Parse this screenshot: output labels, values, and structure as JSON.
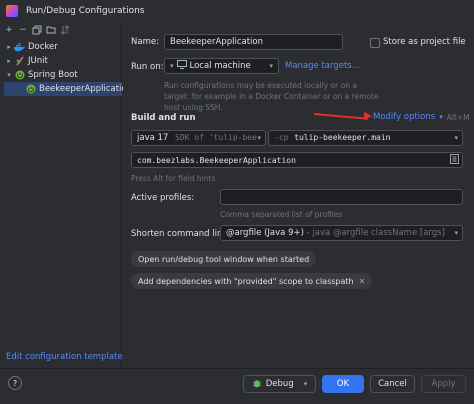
{
  "window": {
    "title": "Run/Debug Configurations"
  },
  "toolbar": {
    "add": "+",
    "remove": "−"
  },
  "tree": {
    "items": [
      {
        "label": "Docker",
        "expanded": false
      },
      {
        "label": "JUnit",
        "expanded": false
      },
      {
        "label": "Spring Boot",
        "expanded": true
      },
      {
        "label": "BeekeeperApplication",
        "selected": true
      }
    ],
    "edit_templates": "Edit configuration templates..."
  },
  "form": {
    "name_label": "Name:",
    "name_value": "BeekeeperApplication",
    "store_label": "Store as project file",
    "run_on_label": "Run on:",
    "run_on_value": "Local machine",
    "manage_targets": "Manage targets...",
    "run_on_hint": "Run configurations may be executed locally or on a target: for example in a Docker Container or on a remote host using SSH.",
    "build_run_title": "Build and run",
    "modify_options": "Modify options",
    "modify_shortcut": "Alt+M",
    "jdk_value": "java 17",
    "jdk_detail": "SDK of 'tulip-bee",
    "cp_prefix": "-cp",
    "cp_value": "tulip-beekeeper.main",
    "main_class": "com.beezlabs.BeekeeperApplication",
    "field_hint": "Press Alt for field hints",
    "active_profiles_label": "Active profiles:",
    "active_profiles_value": "",
    "profiles_hint": "Comma separated list of profiles",
    "shorten_label": "Shorten command line:",
    "shorten_value": "@argfile (Java 9+)",
    "shorten_detail": " - java @argfile className [args]",
    "chips": [
      "Open run/debug tool window when started",
      "Add dependencies with \"provided\" scope to classpath"
    ]
  },
  "buttons": {
    "help": "?",
    "debug": "Debug",
    "ok": "OK",
    "cancel": "Cancel",
    "apply": "Apply"
  },
  "colors": {
    "accent": "#3574f0",
    "link": "#548af7",
    "annotation_arrow": "#e0312b"
  },
  "icons": [
    "run-debug-icon",
    "add-icon",
    "remove-icon",
    "copy-icon",
    "folder-icon",
    "sort-icon",
    "docker-icon",
    "junit-icon",
    "spring-boot-icon",
    "chevron-down-icon",
    "close-icon",
    "bug-icon",
    "help-icon"
  ]
}
